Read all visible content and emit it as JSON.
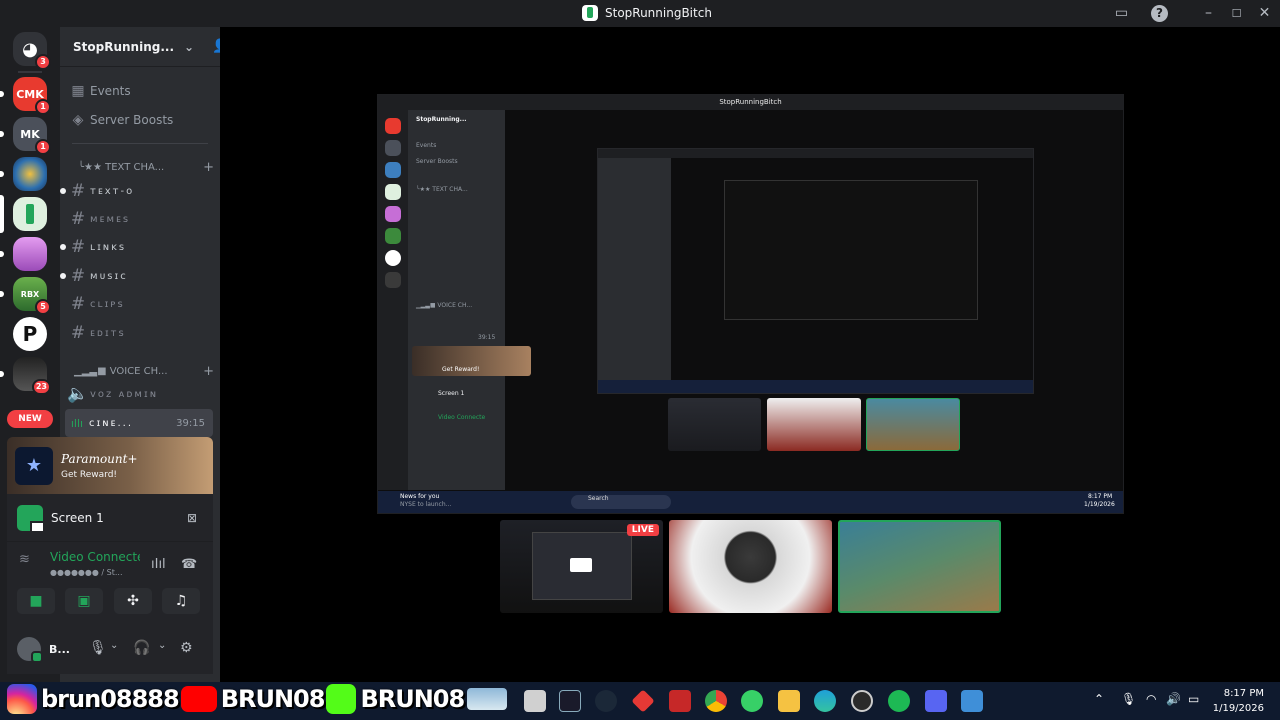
{
  "window": {
    "title": "StopRunningBitch"
  },
  "servers": [
    {
      "name": "discord-home",
      "badge": "3",
      "color": "#5865f2",
      "label": "◉"
    },
    {
      "name": "cmk",
      "badge": "1",
      "color": "#e83a2f",
      "label": "CMK"
    },
    {
      "name": "mk",
      "badge": "1",
      "color": "#555a64",
      "label": "MK"
    },
    {
      "name": "gsound",
      "badge": "",
      "color": "#3d7fbf",
      "label": "●"
    },
    {
      "name": "stoprunning",
      "badge": "",
      "color": "#e8f4e8",
      "label": ""
    },
    {
      "name": "purple",
      "badge": "",
      "color": "#c66ed6",
      "label": ""
    },
    {
      "name": "roblox",
      "badge": "5",
      "color": "#3c8a3c",
      "label": "RBX"
    },
    {
      "name": "p-server",
      "badge": "",
      "color": "#ffffff",
      "label": "P"
    },
    {
      "name": "dark",
      "badge": "23",
      "color": "#3a3a3a",
      "label": ""
    }
  ],
  "new_label": "NEW",
  "guild": {
    "name": "StopRunning..."
  },
  "nav": {
    "events": "Events",
    "boosts": "Server Boosts"
  },
  "text_category": "╰★★ TEXT CHA...",
  "text_channels": [
    "ᴛᴇxᴛ-ᴏ",
    "ᴍᴇᴍᴇs",
    "ʟɪɴᴋs",
    "ᴍᴜsɪᴄ",
    "ᴄʟɪᴘs",
    "ᴇᴅɪᴛs"
  ],
  "voice_category": "▁▂▃■ VOICE CH...",
  "voice_channels": [
    {
      "name": "ᴠᴏᴢ ᴀᴅᴍɪɴ"
    }
  ],
  "active_voice": {
    "name": "ᴄɪɴᴇ...",
    "timer": "39:15"
  },
  "promo": {
    "brand": "Paramount+",
    "cta": "Get Reward!"
  },
  "screenshare": {
    "label": "Screen 1"
  },
  "connection": {
    "status": "Video Connecte",
    "detail": "●●●●●●● / St..."
  },
  "user": {
    "name": "B..."
  },
  "mirror": {
    "title": "StopRunningBitch",
    "guild": "StopRunning...",
    "events": "Events",
    "boosts": "Server Boosts",
    "screen": "Screen 1",
    "status": "Video Connecte",
    "promo_cta": "Get Reward!",
    "news": "News for you",
    "news_sub": "NYSE to launch...",
    "search": "Search",
    "time": "8:17 PM",
    "date": "1/19/2026",
    "timer": "39:15",
    "text_category": "╰★★ TEXT CHA...",
    "voice_category": "▁▂▃■ VOICE CH..."
  },
  "stream_tiles": [
    {
      "name": "screen-stream",
      "live": "LIVE"
    },
    {
      "name": "webcam-hat"
    },
    {
      "name": "webcam-smile"
    }
  ],
  "social": {
    "instagram": "brun08888",
    "youtube": "BRUN08",
    "kick": "BRUN08"
  },
  "clock": {
    "time": "8:17 PM",
    "date": "1/19/2026"
  }
}
